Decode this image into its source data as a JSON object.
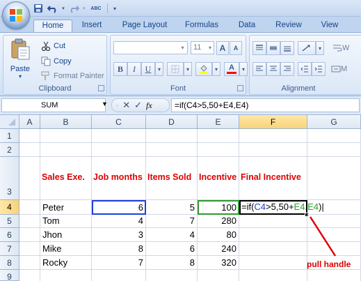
{
  "quick_access": {
    "save_icon": "save-icon",
    "undo_icon": "undo-icon",
    "redo_icon": "redo-icon",
    "spelling_icon": "spelling-icon",
    "spelling_label": "ABC"
  },
  "tabs": [
    {
      "label": "Home",
      "active": true
    },
    {
      "label": "Insert"
    },
    {
      "label": "Page Layout"
    },
    {
      "label": "Formulas"
    },
    {
      "label": "Data"
    },
    {
      "label": "Review"
    },
    {
      "label": "View"
    }
  ],
  "ribbon": {
    "clipboard": {
      "label": "Clipboard",
      "paste": "Paste",
      "cut": "Cut",
      "copy": "Copy",
      "format_painter": "Format Painter"
    },
    "font": {
      "label": "Font",
      "font_name": "",
      "font_size": "11",
      "bold": "B",
      "italic": "I",
      "underline": "U",
      "grow": "A",
      "shrink": "A",
      "font_color": "A"
    },
    "alignment": {
      "label": "Alignment",
      "wrap_partial": "W",
      "merge_partial": "M"
    }
  },
  "formula_bar": {
    "name_box": "SUM",
    "fx": "fx",
    "cancel": "✕",
    "enter": "✓",
    "formula": "=if(C4>5,50+E4,E4)"
  },
  "grid": {
    "columns": [
      "A",
      "B",
      "C",
      "D",
      "E",
      "F",
      "G"
    ],
    "rows": [
      "1",
      "2",
      "3",
      "4",
      "5",
      "6",
      "7",
      "8",
      "9"
    ],
    "headers": {
      "b3": "Sales Exe.",
      "c3": "Job months",
      "d3": "Items Sold",
      "e3": "Incentive",
      "f3": "Final Incentive"
    },
    "data_rows": [
      {
        "name": "Peter",
        "months": "6",
        "items": "5",
        "incentive": "100"
      },
      {
        "name": "Tom",
        "months": "4",
        "items": "7",
        "incentive": "280"
      },
      {
        "name": "Jhon",
        "months": "3",
        "items": "4",
        "incentive": "80"
      },
      {
        "name": "Mike",
        "months": "8",
        "items": "6",
        "incentive": "240"
      },
      {
        "name": "Rocky",
        "months": "7",
        "items": "8",
        "incentive": "320"
      }
    ],
    "editing_cell": {
      "p1": "=if(",
      "p2": "C4",
      "p3": ">5,50+",
      "p4": "E4",
      "p5": ",",
      "p6": "E4",
      "p7": ")"
    },
    "ref_colors": {
      "c4": "#1f3fd6",
      "e4": "#2e9a2e"
    }
  },
  "annotation": {
    "text": "pull handle",
    "color": "#e00000"
  }
}
